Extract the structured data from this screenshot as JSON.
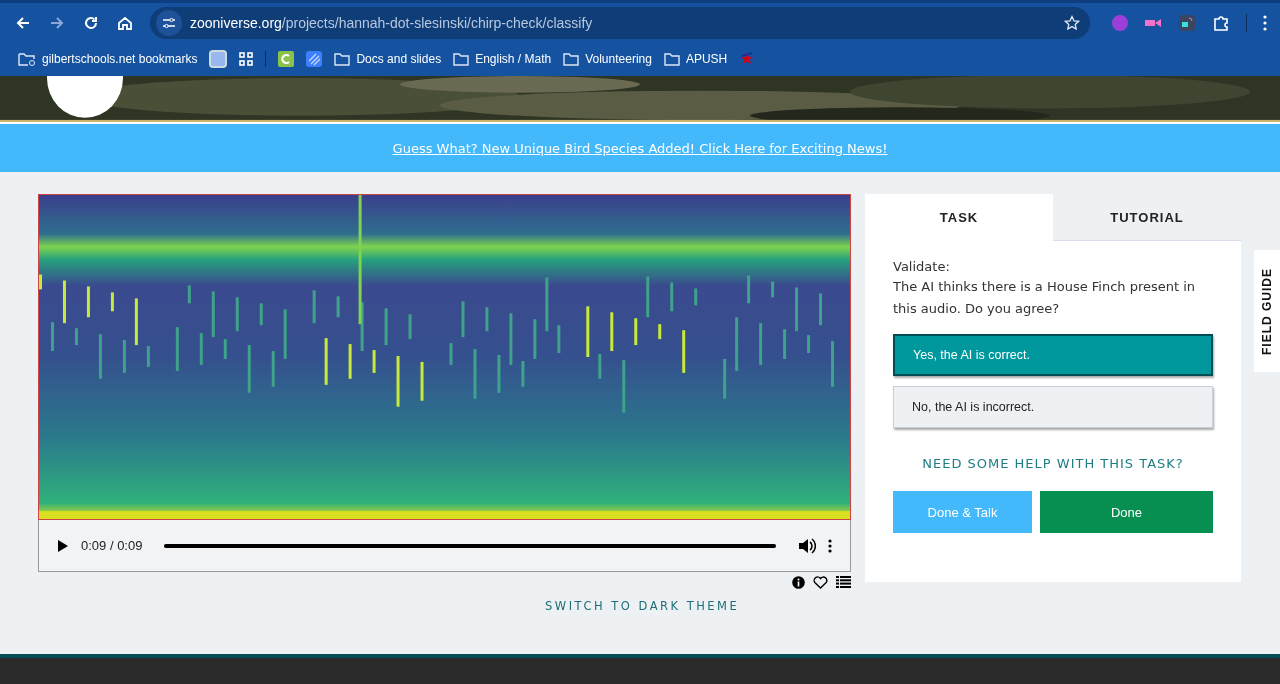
{
  "browser": {
    "url": {
      "domain": "zooniverse.org",
      "path": "/projects/hannah-dot-slesinski/chirp-check/classify"
    },
    "bookmarks": [
      {
        "kind": "managed",
        "label": "gilbertschools.net bookmarks"
      },
      {
        "kind": "square"
      },
      {
        "kind": "apps"
      },
      {
        "kind": "separator"
      },
      {
        "kind": "c-app"
      },
      {
        "kind": "stripes"
      },
      {
        "kind": "folder",
        "label": "Docs and slides"
      },
      {
        "kind": "folder",
        "label": "English / Math"
      },
      {
        "kind": "folder",
        "label": "Volunteering"
      },
      {
        "kind": "folder",
        "label": "APUSH"
      },
      {
        "kind": "star"
      }
    ]
  },
  "banner": {
    "link": "Guess What? New Unique Bird Species Added! Click Here for Exciting News!"
  },
  "player": {
    "time": "0:09 / 0:09",
    "level": 1
  },
  "task": {
    "tabs": [
      {
        "label": "TASK",
        "selected": true
      },
      {
        "label": "TUTORIAL",
        "selected": false
      }
    ],
    "prompt_title": "Validate:",
    "prompt": "The AI thinks there is a House Finch present in this audio. Do you agree?",
    "answers": [
      {
        "label": "Yes, the AI is correct.",
        "selected": true
      },
      {
        "label": "No, the AI is incorrect.",
        "selected": false
      }
    ],
    "help": "NEED SOME HELP WITH THIS TASK?",
    "buttons": [
      {
        "kind": "talk",
        "label": "Done & Talk"
      },
      {
        "kind": "done",
        "label": "Done"
      }
    ]
  },
  "field_guide": "FIELD GUIDE",
  "theme_link": "SWITCH TO DARK THEME"
}
